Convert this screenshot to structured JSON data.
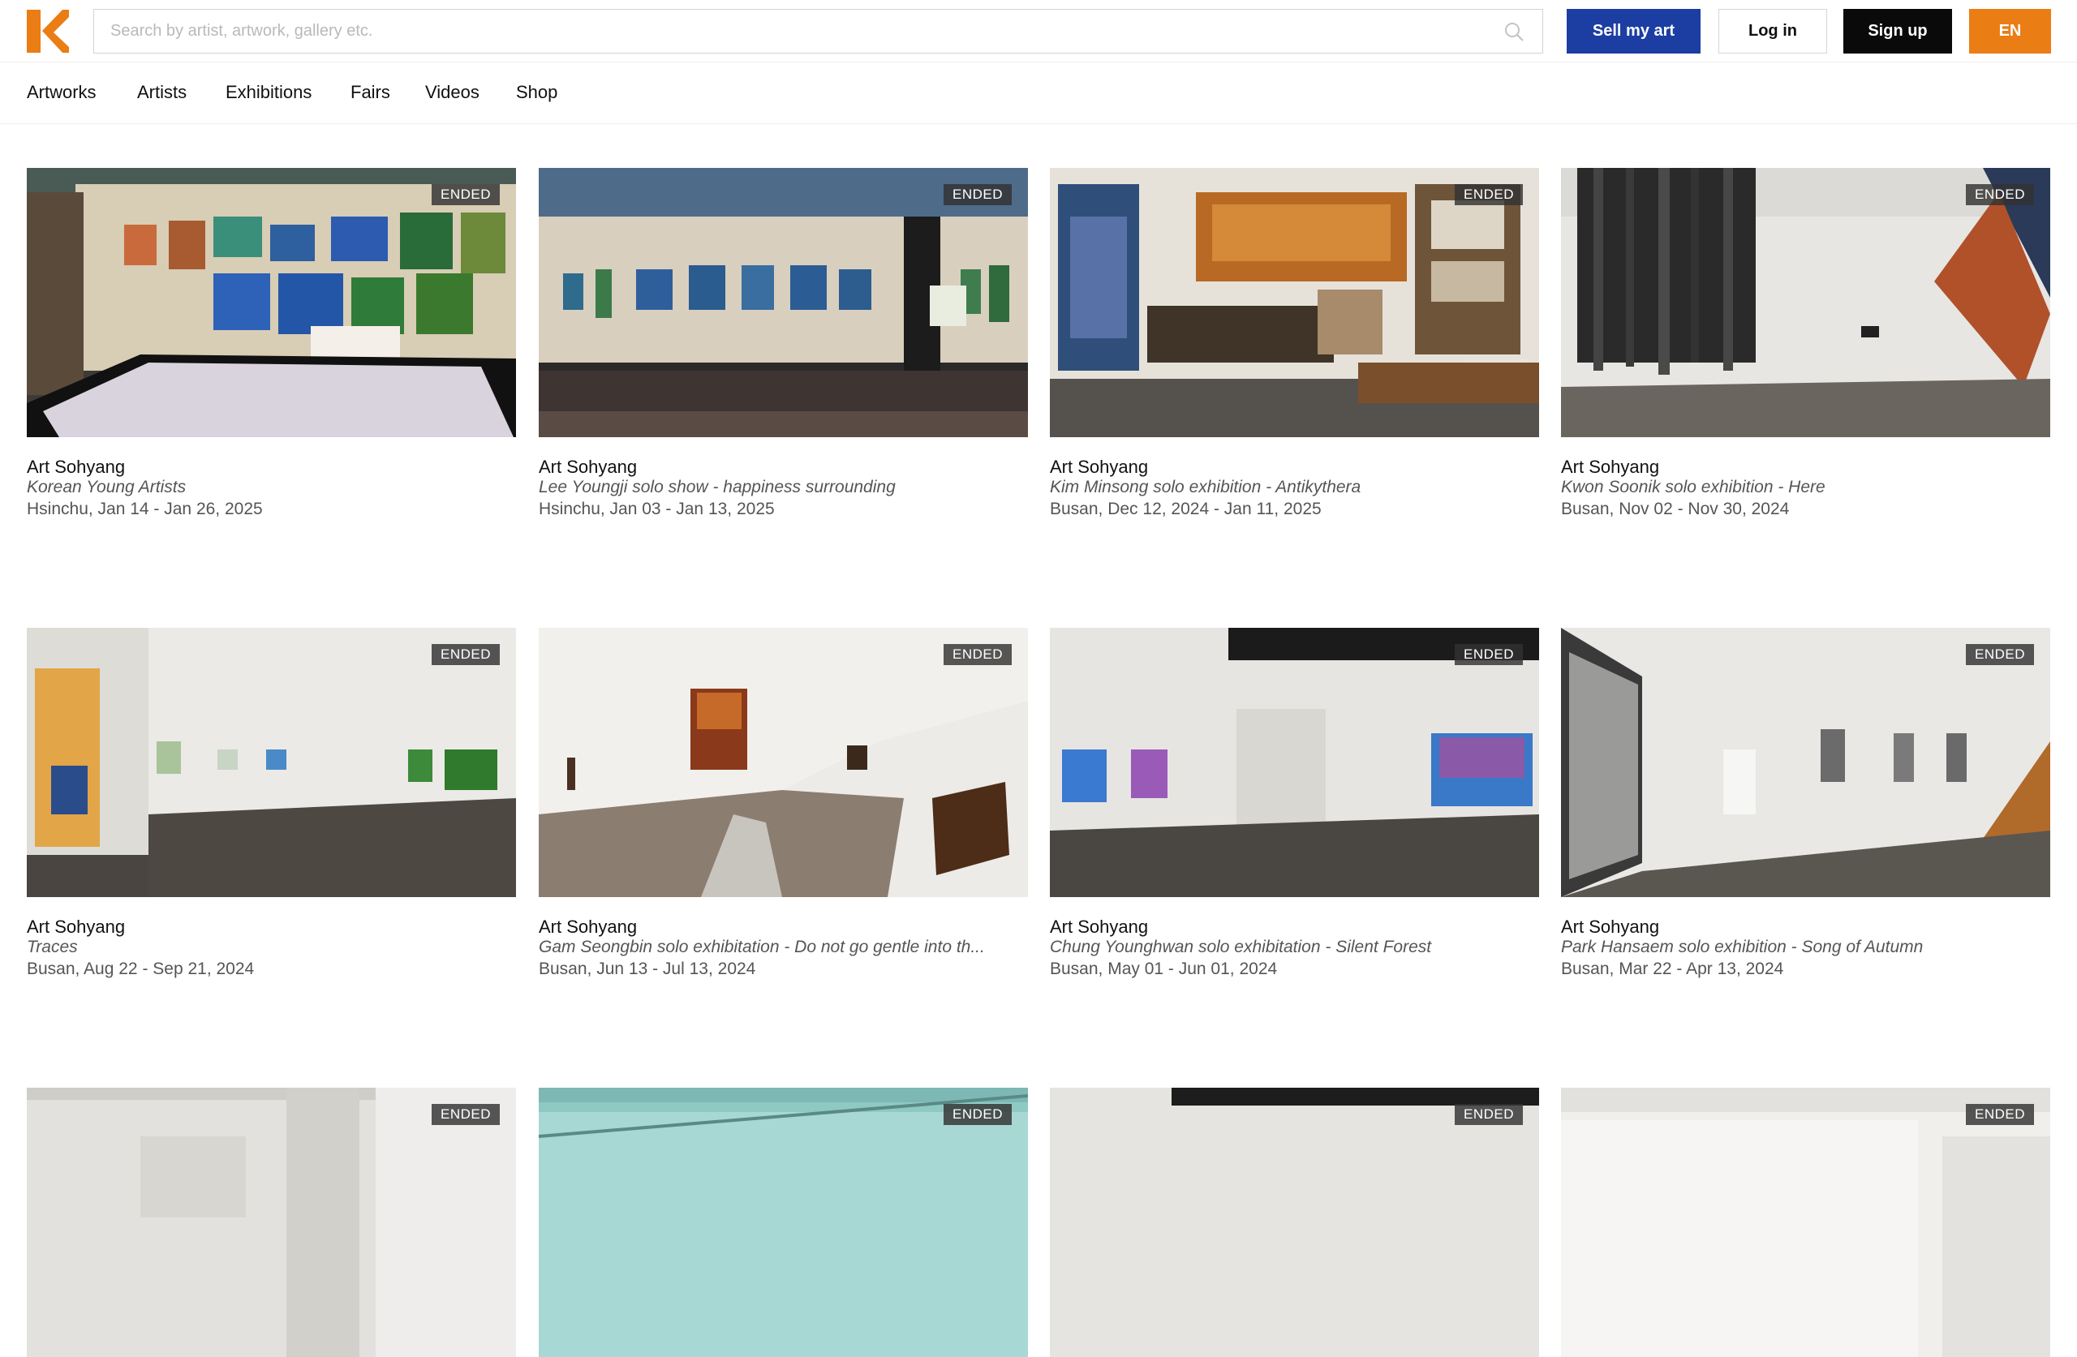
{
  "header": {
    "search_placeholder": "Search by artist, artwork, gallery etc.",
    "sell_label": "Sell my art",
    "login_label": "Log in",
    "signup_label": "Sign up",
    "lang_label": "EN"
  },
  "nav": {
    "items": [
      {
        "label": "Artworks"
      },
      {
        "label": "Artists"
      },
      {
        "label": "Exhibitions"
      },
      {
        "label": "Fairs"
      },
      {
        "label": "Videos"
      },
      {
        "label": "Shop"
      }
    ]
  },
  "colors": {
    "brand_orange": "#ea7d14",
    "sell_blue": "#1c3ea3",
    "signup_black": "#0a0a0a"
  },
  "exhibitions": [
    {
      "badge": "ENDED",
      "gallery": "Art Sohyang",
      "title": "Korean Young Artists",
      "dates": "Hsinchu, Jan 14 - Jan 26, 2025"
    },
    {
      "badge": "ENDED",
      "gallery": "Art Sohyang",
      "title": "Lee Youngji solo show - happiness surrounding",
      "dates": "Hsinchu, Jan 03 - Jan 13, 2025"
    },
    {
      "badge": "ENDED",
      "gallery": "Art Sohyang",
      "title": "Kim Minsong solo exhibition - Antikythera",
      "dates": "Busan, Dec 12, 2024 - Jan 11, 2025"
    },
    {
      "badge": "ENDED",
      "gallery": "Art Sohyang",
      "title": "Kwon Soonik solo exhibition - Here",
      "dates": "Busan, Nov 02 - Nov 30, 2024"
    },
    {
      "badge": "ENDED",
      "gallery": "Art Sohyang",
      "title": "Traces",
      "dates": "Busan, Aug 22 - Sep 21, 2024"
    },
    {
      "badge": "ENDED",
      "gallery": "Art Sohyang",
      "title": "Gam Seongbin solo exhibitation - Do not go gentle into th...",
      "dates": "Busan, Jun 13 - Jul 13, 2024"
    },
    {
      "badge": "ENDED",
      "gallery": "Art Sohyang",
      "title": "Chung Younghwan solo exhibitation - Silent Forest",
      "dates": "Busan, May 01 - Jun 01, 2024"
    },
    {
      "badge": "ENDED",
      "gallery": "Art Sohyang",
      "title": "Park Hansaem solo exhibition - Song of Autumn",
      "dates": "Busan, Mar 22 - Apr 13, 2024"
    },
    {
      "badge": "ENDED"
    },
    {
      "badge": "ENDED"
    },
    {
      "badge": "ENDED"
    },
    {
      "badge": "ENDED"
    }
  ]
}
